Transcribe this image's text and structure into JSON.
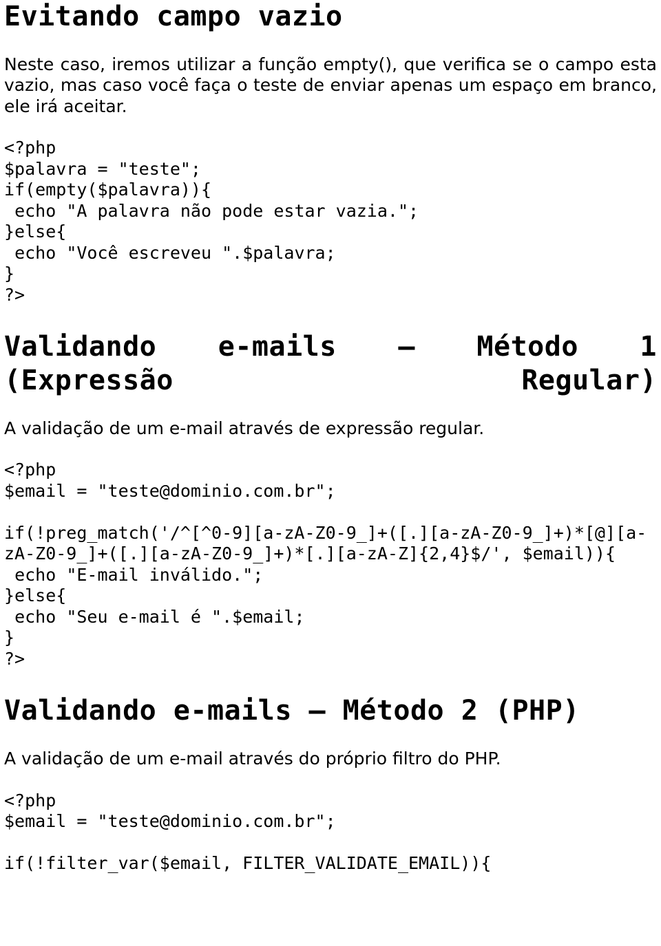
{
  "section1": {
    "title": "Evitando campo vazio",
    "paragraph": "Neste caso, iremos utilizar a função empty(), que verifica se o campo esta vazio, mas caso você faça o teste de enviar apenas um espaço em branco, ele irá aceitar.",
    "code": "<?php\n$palavra = \"teste\";\nif(empty($palavra)){\n echo \"A palavra não pode estar vazia.\";\n}else{\n echo \"Você escreveu \".$palavra;\n}\n?>"
  },
  "section2": {
    "title": "Validando e-mails – Método 1 (Expressão Regular)",
    "paragraph": "A validação de um e-mail através de expressão regular.",
    "code": "<?php\n$email = \"teste@dominio.com.br\";\n\nif(!preg_match('/^[^0-9][a-zA-Z0-9_]+([.][a-zA-Z0-9_]+)*[@][a-zA-Z0-9_]+([.][a-zA-Z0-9_]+)*[.][a-zA-Z]{2,4}$/', $email)){\n echo \"E-mail inválido.\";\n}else{\n echo \"Seu e-mail é \".$email;\n}\n?>"
  },
  "section3": {
    "title": "Validando e-mails – Método 2 (PHP)",
    "paragraph": "A validação de um e-mail através do próprio filtro do PHP.",
    "code": "<?php\n$email = \"teste@dominio.com.br\";\n\nif(!filter_var($email, FILTER_VALIDATE_EMAIL)){"
  }
}
